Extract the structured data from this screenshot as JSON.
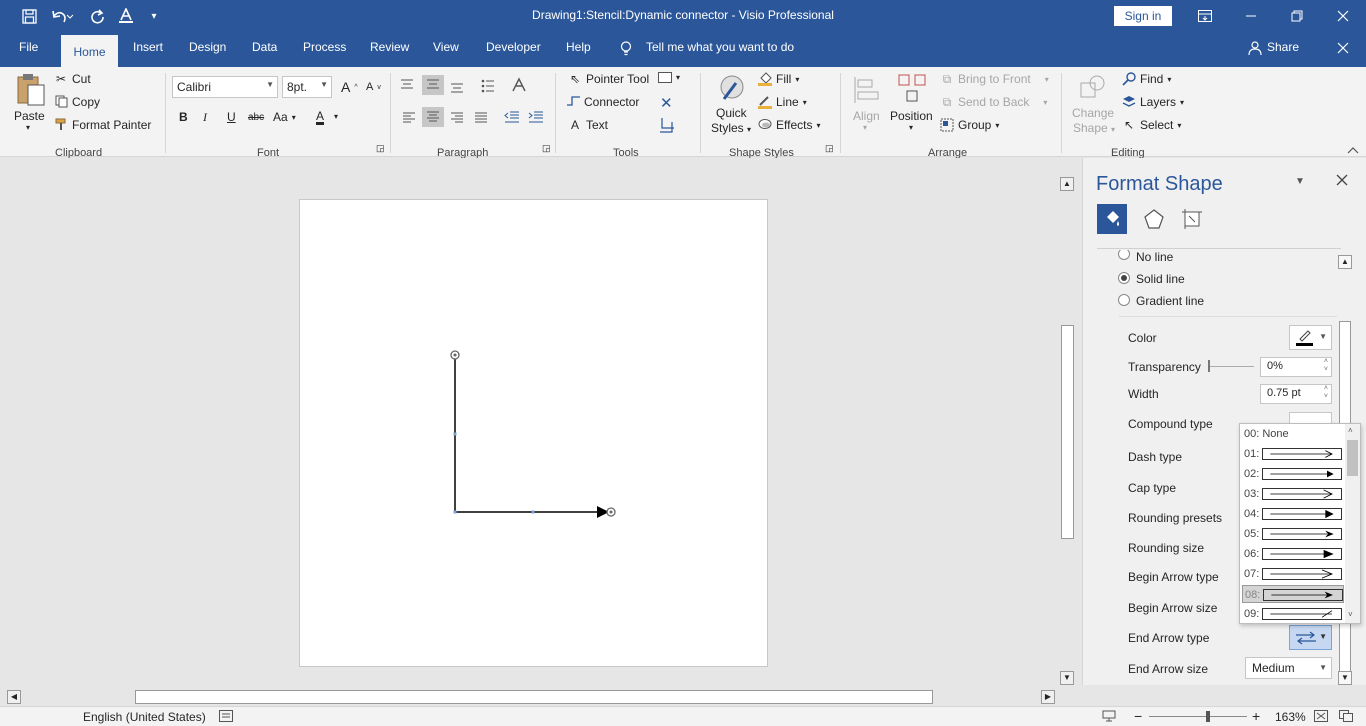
{
  "title_bar": {
    "title": "Drawing1:Stencil:Dynamic connector  -  Visio Professional",
    "sign_in": "Sign in"
  },
  "tabs": [
    "File",
    "Home",
    "Insert",
    "Design",
    "Data",
    "Process",
    "Review",
    "View",
    "Developer",
    "Help"
  ],
  "tell_me": "Tell me what you want to do",
  "share": "Share",
  "ribbon": {
    "clipboard": {
      "paste": "Paste",
      "cut": "Cut",
      "copy": "Copy",
      "format_painter": "Format Painter",
      "group": "Clipboard"
    },
    "font": {
      "name": "Calibri",
      "size": "8pt.",
      "group": "Font"
    },
    "paragraph": {
      "group": "Paragraph"
    },
    "tools": {
      "pointer": "Pointer Tool",
      "connector": "Connector",
      "text": "Text",
      "group": "Tools"
    },
    "shape_styles": {
      "quick1": "Quick",
      "quick2": "Styles",
      "fill": "Fill",
      "line": "Line",
      "effects": "Effects",
      "group": "Shape Styles"
    },
    "arrange": {
      "align": "Align",
      "position": "Position",
      "bring_front": "Bring to Front",
      "send_back": "Send to Back",
      "group_btn": "Group",
      "group": "Arrange"
    },
    "editing": {
      "change1": "Change",
      "change2": "Shape",
      "find": "Find",
      "layers": "Layers",
      "select": "Select",
      "group": "Editing"
    }
  },
  "panel": {
    "title": "Format Shape",
    "line_options": {
      "no_line": "No line",
      "solid_line": "Solid line",
      "gradient_line": "Gradient line"
    },
    "selected_line": "Solid line",
    "props": {
      "color": "Color",
      "transparency": "Transparency",
      "transparency_val": "0%",
      "width": "Width",
      "width_val": "0.75 pt",
      "compound": "Compound type",
      "dash": "Dash type",
      "cap": "Cap type",
      "rounding_presets": "Rounding presets",
      "rounding_size": "Rounding size",
      "begin_arrow_type": "Begin Arrow type",
      "begin_arrow_size": "Begin Arrow size",
      "end_arrow_type": "End Arrow type",
      "end_arrow_size": "End Arrow size",
      "end_arrow_size_val": "Medium"
    }
  },
  "arrow_list": [
    "00: None",
    "01:",
    "02:",
    "03:",
    "04:",
    "05:",
    "06:",
    "07:",
    "08:",
    "09:"
  ],
  "arrow_list_selected": "08:",
  "status": {
    "language": "English (United States)",
    "zoom": "163%"
  }
}
